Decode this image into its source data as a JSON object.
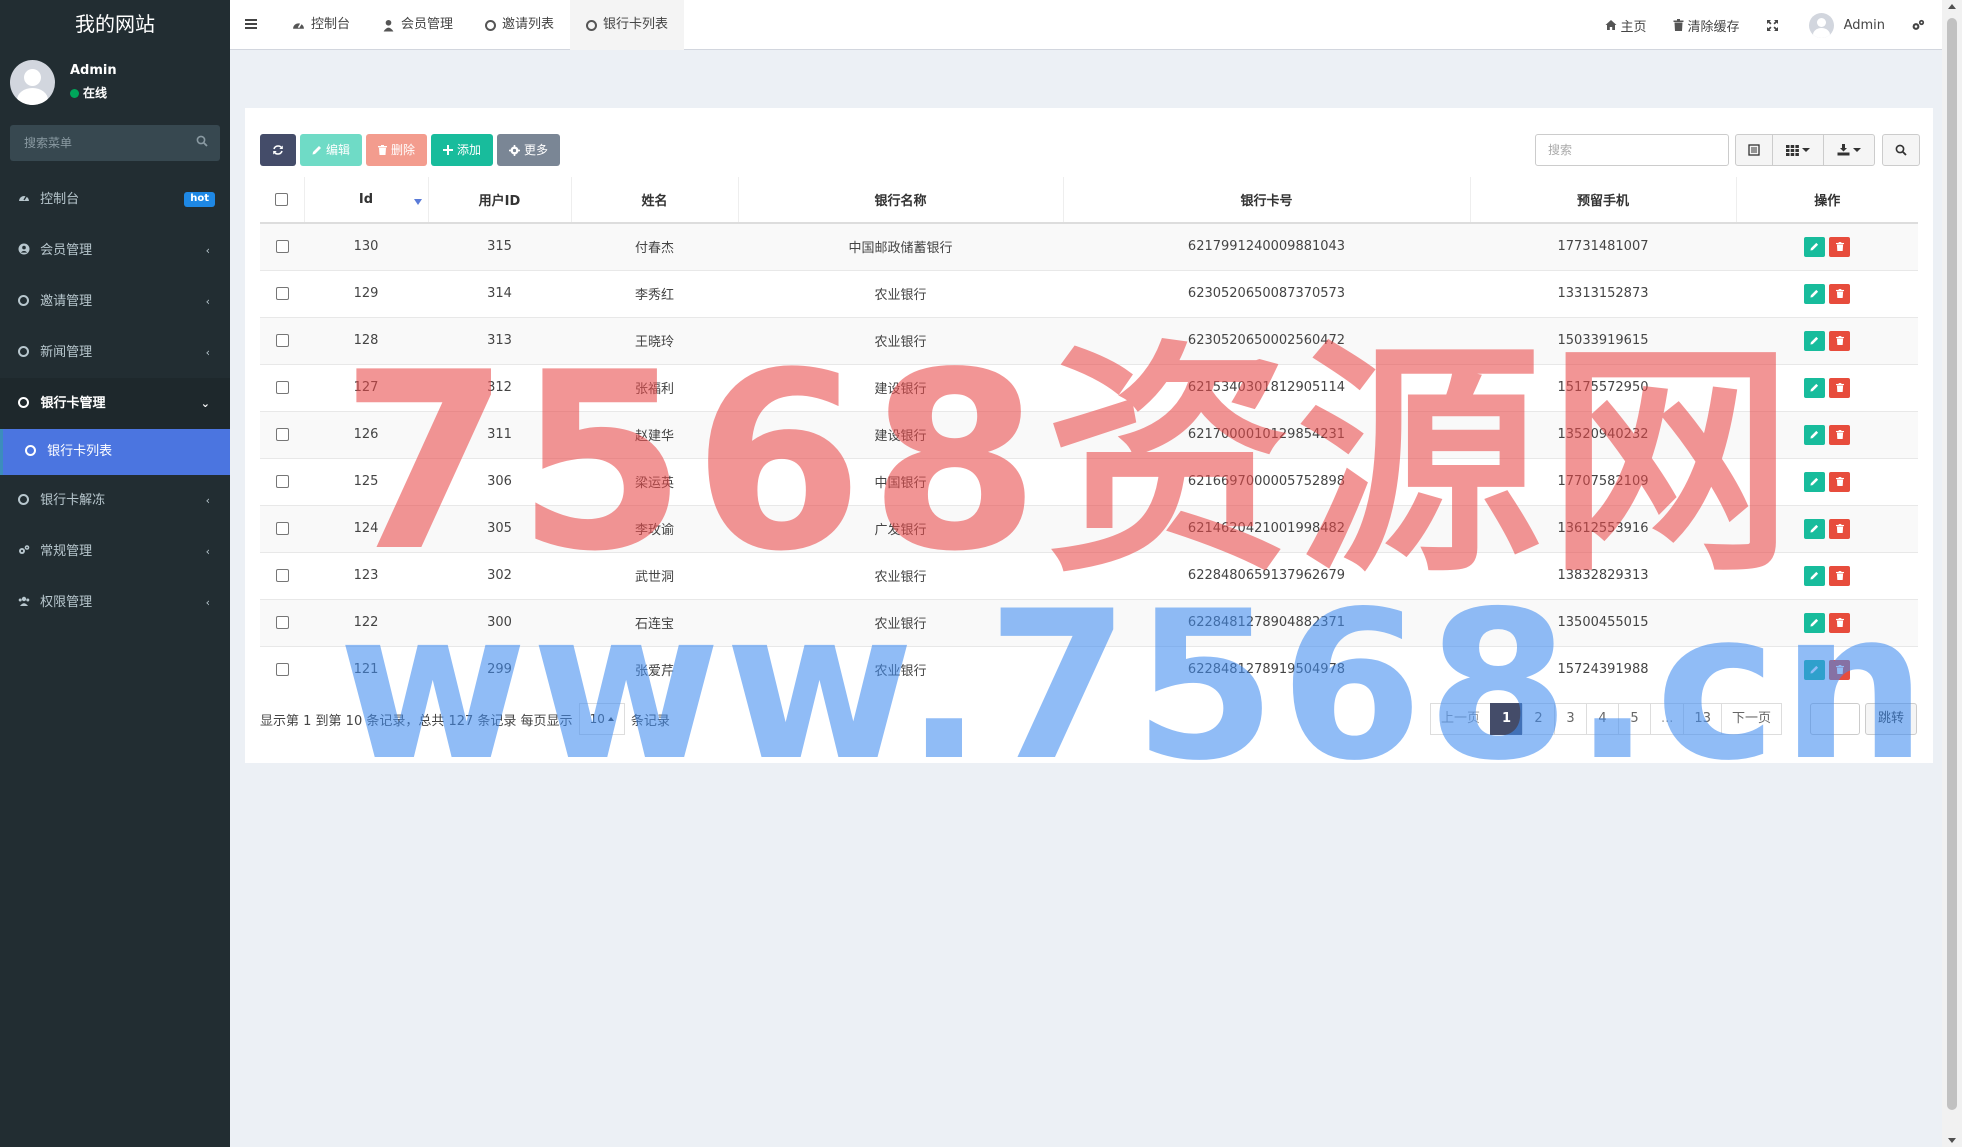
{
  "sidebar": {
    "logo": "我的网站",
    "user": {
      "name": "Admin",
      "status": "在线"
    },
    "search_placeholder": "搜索菜单",
    "items": [
      {
        "label": "控制台",
        "badge": "hot"
      },
      {
        "label": "会员管理"
      },
      {
        "label": "邀请管理"
      },
      {
        "label": "新闻管理"
      },
      {
        "label": "银行卡管理"
      },
      {
        "label": "银行卡列表"
      },
      {
        "label": "银行卡解冻"
      },
      {
        "label": "常规管理"
      },
      {
        "label": "权限管理"
      }
    ]
  },
  "header": {
    "tabs": [
      {
        "label": "控制台"
      },
      {
        "label": "会员管理"
      },
      {
        "label": "邀请列表"
      },
      {
        "label": "银行卡列表"
      }
    ],
    "home": "主页",
    "clear_cache": "清除缓存",
    "user": "Admin"
  },
  "toolbar": {
    "edit": "编辑",
    "delete": "删除",
    "add": "添加",
    "more": "更多",
    "search_placeholder": "搜索"
  },
  "table": {
    "columns": [
      "Id",
      "用户ID",
      "姓名",
      "银行名称",
      "银行卡号",
      "预留手机",
      "操作"
    ],
    "rows": [
      [
        "130",
        "315",
        "付春杰",
        "中国邮政储蓄银行",
        "6217991240009881043",
        "17731481007"
      ],
      [
        "129",
        "314",
        "李秀红",
        "农业银行",
        "6230520650087370573",
        "13313152873"
      ],
      [
        "128",
        "313",
        "王晓玲",
        "农业银行",
        "6230520650002560472",
        "15033919615"
      ],
      [
        "127",
        "312",
        "张福利",
        "建设银行",
        "6215340301812905114",
        "15175572950"
      ],
      [
        "126",
        "311",
        "赵建华",
        "建设银行",
        "6217000010129854231",
        "13520940232"
      ],
      [
        "125",
        "306",
        "梁运英",
        "中国银行",
        "6216697000005752898",
        "17707582109"
      ],
      [
        "124",
        "305",
        "李玫谕",
        "广发银行",
        "6214620421001998482",
        "13612553916"
      ],
      [
        "123",
        "302",
        "武世洞",
        "农业银行",
        "6228480659137962679",
        "13832829313"
      ],
      [
        "122",
        "300",
        "石连宝",
        "农业银行",
        "6228481278904882371",
        "13500455015"
      ],
      [
        "121",
        "299",
        "张爱芹",
        "农业银行",
        "6228481278919504978",
        "15724391988"
      ]
    ]
  },
  "footer": {
    "info_prefix": "显示第 1 到第 10 条记录，总共 127 条记录 每页显示",
    "page_size": "10",
    "info_suffix": "条记录",
    "pages": [
      "上一页",
      "1",
      "2",
      "3",
      "4",
      "5",
      "...",
      "13",
      "下一页"
    ],
    "jump": "跳转"
  },
  "watermark": {
    "line1": "7568资源网",
    "line2": "www.7568.cn"
  },
  "colors": {
    "sidebar_bg": "#222d32",
    "active_menu": "#4b75e0",
    "primary_dark": "#444c69",
    "success": "#18bc9c",
    "danger": "#e74c3c"
  }
}
